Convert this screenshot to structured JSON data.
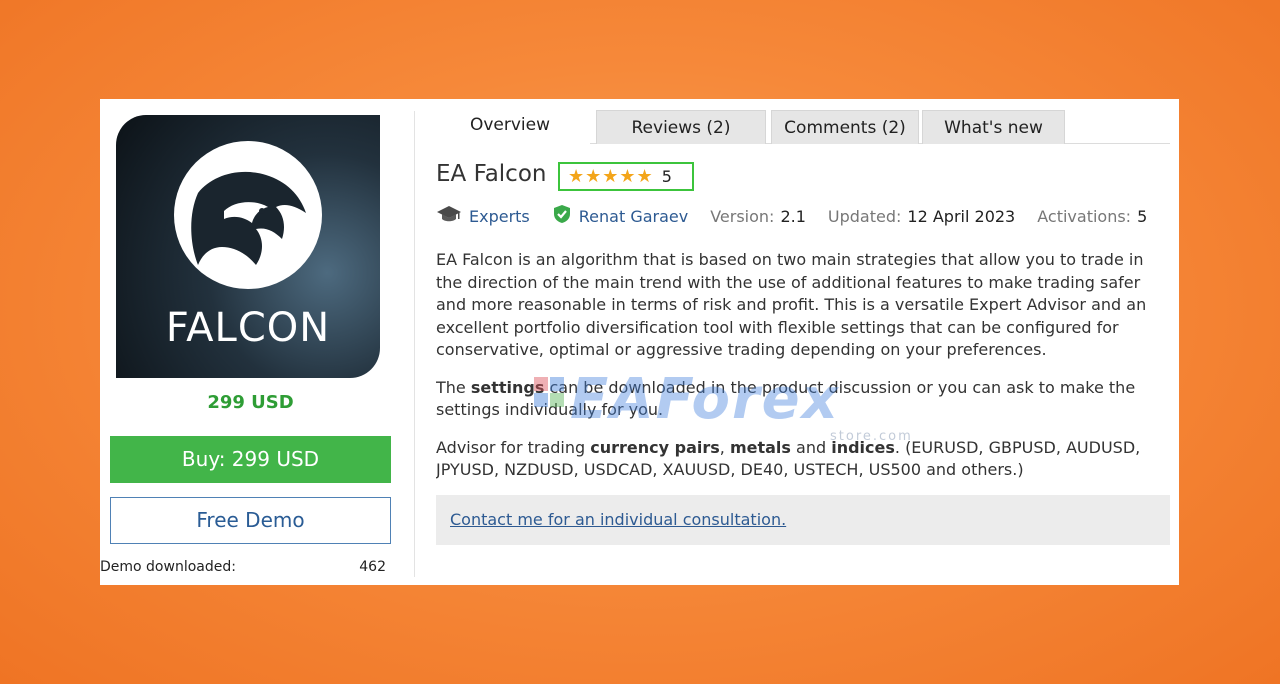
{
  "product": {
    "logo_text": "FALCON",
    "price": "299 USD",
    "buy_label": "Buy: 299 USD",
    "demo_label": "Free Demo",
    "demo_downloaded_label": "Demo downloaded:",
    "demo_downloaded_count": "462"
  },
  "tabs": [
    {
      "label": "Overview",
      "active": true
    },
    {
      "label": "Reviews (2)",
      "active": false
    },
    {
      "label": "Comments (2)",
      "active": false
    },
    {
      "label": "What's new",
      "active": false
    }
  ],
  "header": {
    "title": "EA Falcon",
    "stars": "★★★★★",
    "rating": "5"
  },
  "meta": {
    "category": "Experts",
    "author": "Renat Garaev",
    "version_label": "Version:",
    "version_value": "2.1",
    "updated_label": "Updated:",
    "updated_value": "12 April 2023",
    "activations_label": "Activations:",
    "activations_value": "5"
  },
  "description": {
    "p1_lines": [
      "EA Falcon is an algorithm that is based on two main strategies that allow you to trade in",
      "the direction of the main trend with the use of additional features to make trading safer",
      "and more reasonable in terms of risk and profit. This is a versatile Expert Advisor and an",
      "excellent portfolio diversification tool with flexible settings that can be configured for",
      "conservative, optimal or aggressive trading depending on your preferences."
    ],
    "p2_a": "The ",
    "p2_b": "settings",
    "p2_c": " can be downloaded in the product discussion or you can ask to make the",
    "p2_line2": "settings individually for you.",
    "p3_a": "Advisor for trading ",
    "p3_b": "currency pairs",
    "p3_c": ", ",
    "p3_d": "metals",
    "p3_e": " and ",
    "p3_f": "indices",
    "p3_g": ". (EURUSD, GBPUSD, AUDUSD,",
    "p3_line2": "JPYUSD, NZDUSD, USDCAD, XAUUSD, DE40, USTECH, US500 and others.)",
    "contact_link": "Contact me for an individual consultation."
  },
  "watermark": {
    "text": "EAForex",
    "sub": "store.com"
  },
  "colors": {
    "background": "#f6893a",
    "buy_green": "#42b549",
    "price_green": "#2e9d35",
    "link_blue": "#2d5a92",
    "star_gold": "#f3a51a",
    "rating_border": "#3cc43c"
  }
}
